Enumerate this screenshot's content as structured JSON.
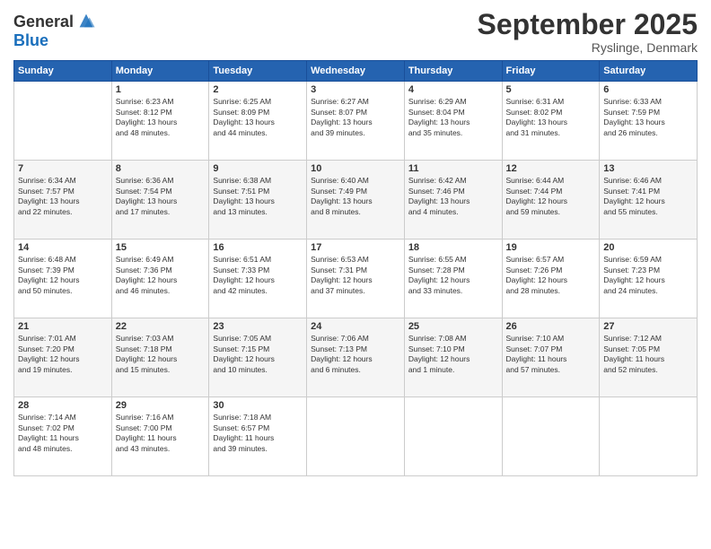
{
  "header": {
    "logo_line1": "General",
    "logo_line2": "Blue",
    "month": "September 2025",
    "location": "Ryslinge, Denmark"
  },
  "weekdays": [
    "Sunday",
    "Monday",
    "Tuesday",
    "Wednesday",
    "Thursday",
    "Friday",
    "Saturday"
  ],
  "weeks": [
    [
      {
        "day": "",
        "content": ""
      },
      {
        "day": "1",
        "content": "Sunrise: 6:23 AM\nSunset: 8:12 PM\nDaylight: 13 hours\nand 48 minutes."
      },
      {
        "day": "2",
        "content": "Sunrise: 6:25 AM\nSunset: 8:09 PM\nDaylight: 13 hours\nand 44 minutes."
      },
      {
        "day": "3",
        "content": "Sunrise: 6:27 AM\nSunset: 8:07 PM\nDaylight: 13 hours\nand 39 minutes."
      },
      {
        "day": "4",
        "content": "Sunrise: 6:29 AM\nSunset: 8:04 PM\nDaylight: 13 hours\nand 35 minutes."
      },
      {
        "day": "5",
        "content": "Sunrise: 6:31 AM\nSunset: 8:02 PM\nDaylight: 13 hours\nand 31 minutes."
      },
      {
        "day": "6",
        "content": "Sunrise: 6:33 AM\nSunset: 7:59 PM\nDaylight: 13 hours\nand 26 minutes."
      }
    ],
    [
      {
        "day": "7",
        "content": "Sunrise: 6:34 AM\nSunset: 7:57 PM\nDaylight: 13 hours\nand 22 minutes."
      },
      {
        "day": "8",
        "content": "Sunrise: 6:36 AM\nSunset: 7:54 PM\nDaylight: 13 hours\nand 17 minutes."
      },
      {
        "day": "9",
        "content": "Sunrise: 6:38 AM\nSunset: 7:51 PM\nDaylight: 13 hours\nand 13 minutes."
      },
      {
        "day": "10",
        "content": "Sunrise: 6:40 AM\nSunset: 7:49 PM\nDaylight: 13 hours\nand 8 minutes."
      },
      {
        "day": "11",
        "content": "Sunrise: 6:42 AM\nSunset: 7:46 PM\nDaylight: 13 hours\nand 4 minutes."
      },
      {
        "day": "12",
        "content": "Sunrise: 6:44 AM\nSunset: 7:44 PM\nDaylight: 12 hours\nand 59 minutes."
      },
      {
        "day": "13",
        "content": "Sunrise: 6:46 AM\nSunset: 7:41 PM\nDaylight: 12 hours\nand 55 minutes."
      }
    ],
    [
      {
        "day": "14",
        "content": "Sunrise: 6:48 AM\nSunset: 7:39 PM\nDaylight: 12 hours\nand 50 minutes."
      },
      {
        "day": "15",
        "content": "Sunrise: 6:49 AM\nSunset: 7:36 PM\nDaylight: 12 hours\nand 46 minutes."
      },
      {
        "day": "16",
        "content": "Sunrise: 6:51 AM\nSunset: 7:33 PM\nDaylight: 12 hours\nand 42 minutes."
      },
      {
        "day": "17",
        "content": "Sunrise: 6:53 AM\nSunset: 7:31 PM\nDaylight: 12 hours\nand 37 minutes."
      },
      {
        "day": "18",
        "content": "Sunrise: 6:55 AM\nSunset: 7:28 PM\nDaylight: 12 hours\nand 33 minutes."
      },
      {
        "day": "19",
        "content": "Sunrise: 6:57 AM\nSunset: 7:26 PM\nDaylight: 12 hours\nand 28 minutes."
      },
      {
        "day": "20",
        "content": "Sunrise: 6:59 AM\nSunset: 7:23 PM\nDaylight: 12 hours\nand 24 minutes."
      }
    ],
    [
      {
        "day": "21",
        "content": "Sunrise: 7:01 AM\nSunset: 7:20 PM\nDaylight: 12 hours\nand 19 minutes."
      },
      {
        "day": "22",
        "content": "Sunrise: 7:03 AM\nSunset: 7:18 PM\nDaylight: 12 hours\nand 15 minutes."
      },
      {
        "day": "23",
        "content": "Sunrise: 7:05 AM\nSunset: 7:15 PM\nDaylight: 12 hours\nand 10 minutes."
      },
      {
        "day": "24",
        "content": "Sunrise: 7:06 AM\nSunset: 7:13 PM\nDaylight: 12 hours\nand 6 minutes."
      },
      {
        "day": "25",
        "content": "Sunrise: 7:08 AM\nSunset: 7:10 PM\nDaylight: 12 hours\nand 1 minute."
      },
      {
        "day": "26",
        "content": "Sunrise: 7:10 AM\nSunset: 7:07 PM\nDaylight: 11 hours\nand 57 minutes."
      },
      {
        "day": "27",
        "content": "Sunrise: 7:12 AM\nSunset: 7:05 PM\nDaylight: 11 hours\nand 52 minutes."
      }
    ],
    [
      {
        "day": "28",
        "content": "Sunrise: 7:14 AM\nSunset: 7:02 PM\nDaylight: 11 hours\nand 48 minutes."
      },
      {
        "day": "29",
        "content": "Sunrise: 7:16 AM\nSunset: 7:00 PM\nDaylight: 11 hours\nand 43 minutes."
      },
      {
        "day": "30",
        "content": "Sunrise: 7:18 AM\nSunset: 6:57 PM\nDaylight: 11 hours\nand 39 minutes."
      },
      {
        "day": "",
        "content": ""
      },
      {
        "day": "",
        "content": ""
      },
      {
        "day": "",
        "content": ""
      },
      {
        "day": "",
        "content": ""
      }
    ]
  ]
}
